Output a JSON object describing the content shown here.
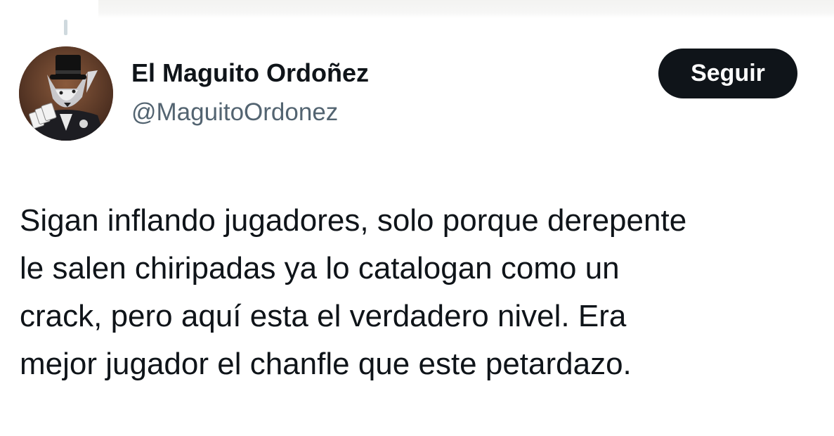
{
  "author": {
    "display_name": "El Maguito Ordoñez",
    "handle": "@MaguitoOrdonez",
    "avatar_icon": "fox-in-top-hat-avatar-icon"
  },
  "actions": {
    "follow_label": "Seguir"
  },
  "tweet": {
    "lines": [
      "Sigan inflando jugadores, solo porque derepente",
      "le salen chiripadas ya lo catalogan como un",
      "crack, pero aquí esta el verdadero nivel. Era",
      "mejor jugador el chanfle que este petardazo."
    ]
  },
  "colors": {
    "text_primary": "#0f1419",
    "text_secondary": "#536471",
    "button_bg": "#0f1419",
    "button_text": "#ffffff"
  }
}
